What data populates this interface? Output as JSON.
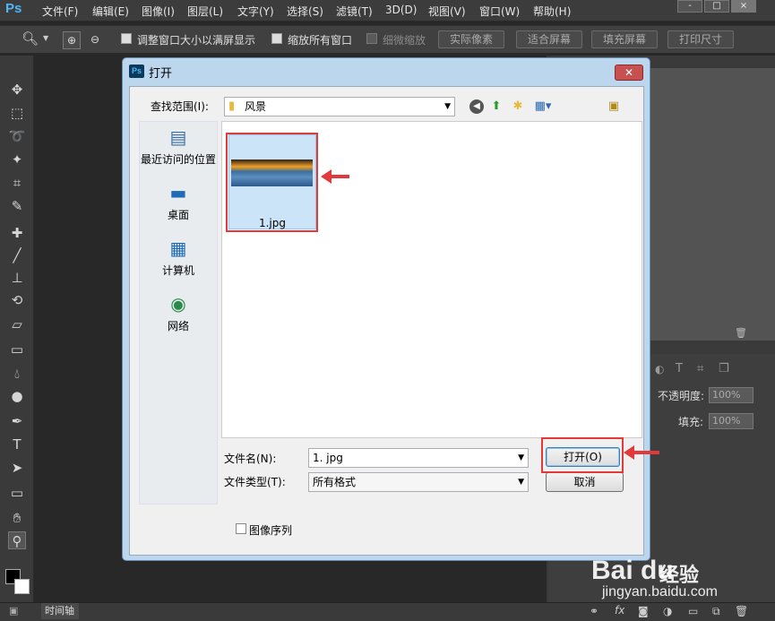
{
  "app": {
    "logo": "Ps",
    "menu": [
      "文件(F)",
      "编辑(E)",
      "图像(I)",
      "图层(L)",
      "文字(Y)",
      "选择(S)",
      "滤镜(T)",
      "3D(D)",
      "视图(V)",
      "窗口(W)",
      "帮助(H)"
    ],
    "window_controls": [
      "-",
      "□",
      "×"
    ]
  },
  "options": {
    "zoom_icon": "zoom-icon",
    "check1": "调整窗口大小以满屏显示",
    "check2": "缩放所有窗口",
    "check3": "细微缩放",
    "buttons": [
      "实际像素",
      "适合屏幕",
      "填充屏幕",
      "打印尺寸"
    ]
  },
  "tools": [
    "move-icon",
    "marquee-icon",
    "lasso-icon",
    "magic-wand-icon",
    "crop-icon",
    "eyedropper-icon",
    "healing-brush-icon",
    "brush-icon",
    "stamp-icon",
    "history-brush-icon",
    "eraser-icon",
    "gradient-icon",
    "blur-icon",
    "dodge-icon",
    "pen-icon",
    "type-icon",
    "path-select-icon",
    "shape-icon",
    "hand-icon",
    "zoom-icon"
  ],
  "layers_panel": {
    "opacity_label": "不透明度:",
    "opacity_value": "100%",
    "fill_label": "填充:",
    "fill_value": "100%"
  },
  "bottom": {
    "timeline_tab": "时间轴"
  },
  "dialog": {
    "title": "打开",
    "ps_icon": "Ps",
    "look_in_label": "查找范围(I):",
    "look_in_value": "风景",
    "places": [
      {
        "label": "最近访问的位置",
        "icon": "recent-places-icon"
      },
      {
        "label": "桌面",
        "icon": "desktop-icon"
      },
      {
        "label": "计算机",
        "icon": "computer-icon"
      },
      {
        "label": "网络",
        "icon": "network-icon"
      }
    ],
    "file": {
      "name": "1.jpg"
    },
    "filename_label": "文件名(N):",
    "filename_value": "1. jpg",
    "filetype_label": "文件类型(T):",
    "filetype_value": "所有格式",
    "open_button": "打开(O)",
    "cancel_button": "取消",
    "image_sequence_label": "图像序列"
  },
  "watermark": {
    "logo": "Bai du",
    "text": "经验",
    "url": "jingyan.baidu.com"
  },
  "colors": {
    "highlight": "#e23a3a",
    "selection": "#cce4f7",
    "ps_blue": "#4fb6f5"
  }
}
